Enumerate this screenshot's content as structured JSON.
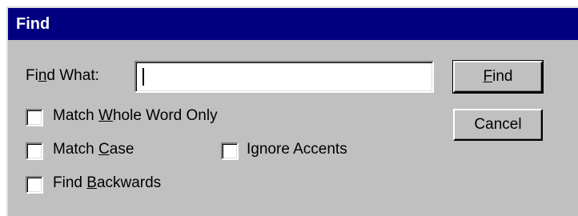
{
  "dialog": {
    "title": "Find"
  },
  "find_what": {
    "label_pre": "Fi",
    "label_accel": "n",
    "label_post": "d What:",
    "value": ""
  },
  "options": {
    "match_whole_word": {
      "pre": "Match ",
      "accel": "W",
      "post": "hole Word Only",
      "checked": false
    },
    "match_case": {
      "pre": "Match ",
      "accel": "C",
      "post": "ase",
      "checked": false
    },
    "ignore_accents": {
      "pre": "I",
      "accel": "g",
      "post": "nore Accents",
      "checked": false
    },
    "find_backwards": {
      "pre": "Find ",
      "accel": "B",
      "post": "ackwards",
      "checked": false
    }
  },
  "buttons": {
    "find": {
      "pre": "",
      "accel": "F",
      "post": "ind"
    },
    "cancel": {
      "label": "Cancel"
    }
  }
}
